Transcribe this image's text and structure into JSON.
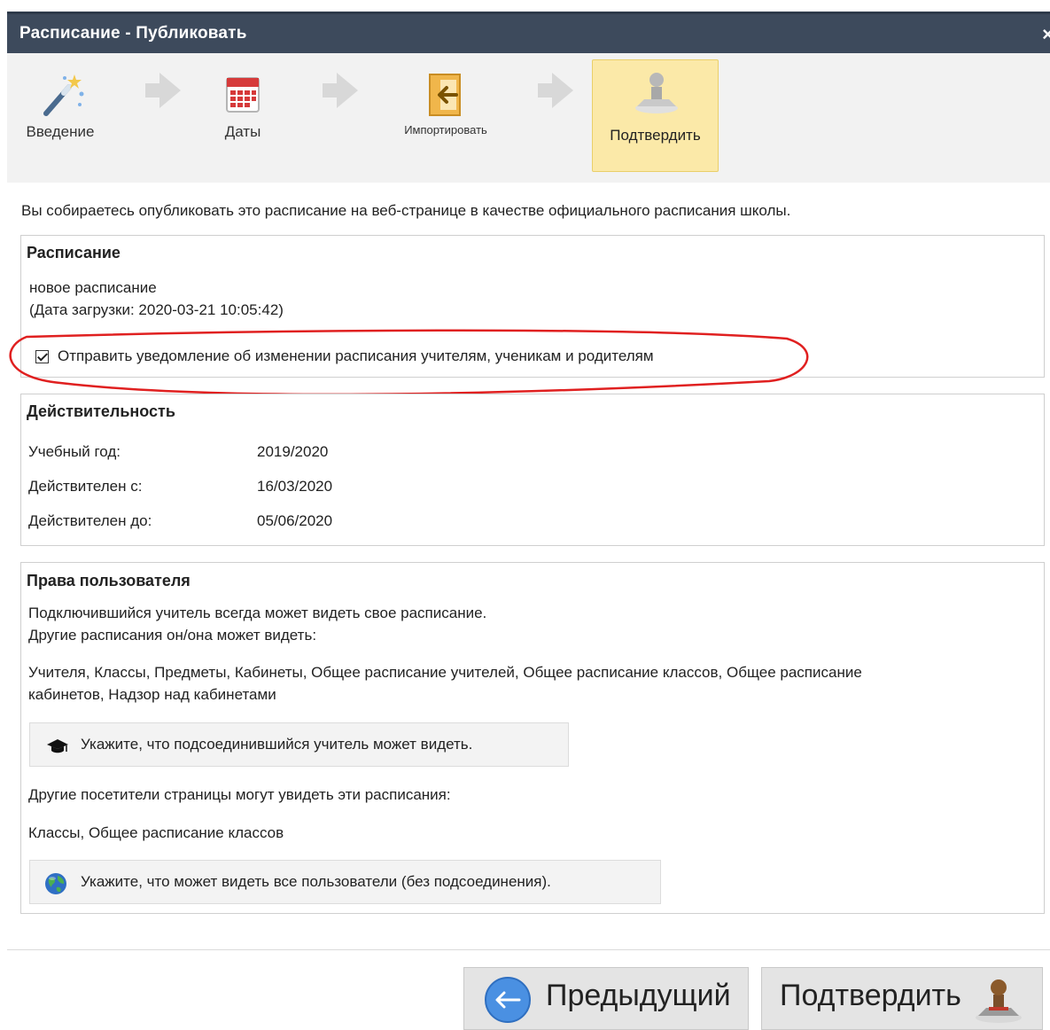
{
  "window": {
    "title": "Расписание - Публиковать",
    "close_label": "×"
  },
  "wizard": {
    "steps": [
      {
        "label": "Введение",
        "icon": "magic-wand-icon"
      },
      {
        "label": "Даты",
        "icon": "calendar-icon"
      },
      {
        "label": "Импортировать",
        "icon": "import-icon"
      },
      {
        "label": "Подтвердить",
        "icon": "stamp-icon",
        "active": true
      }
    ]
  },
  "intro": "Вы собираетесь опубликовать это расписание на веб-странице в качестве официального расписания школы.",
  "schedule_panel": {
    "heading": "Расписание",
    "name": "новое расписание",
    "upload_date": "(Дата загрузки: 2020-03-21 10:05:42)",
    "notify_checkbox": {
      "label": "Отправить уведомление об изменении расписания учителям, ученикам и родителям",
      "checked": true
    }
  },
  "validity_panel": {
    "heading": "Действительность",
    "rows": [
      {
        "label": "Учебный год:",
        "value": "2019/2020"
      },
      {
        "label": "Действителен с:",
        "value": "16/03/2020"
      },
      {
        "label": "Действителен до:",
        "value": "05/06/2020"
      }
    ]
  },
  "rights_panel": {
    "heading": "Права пользователя",
    "teacher_line1": "Подключившийся учитель всегда может видеть свое расписание.",
    "teacher_line2": "Другие расписания он/она может видеть:",
    "teacher_list_line1": "Учителя, Классы, Предметы, Кабинеты, Общее расписание учителей, Общее расписание классов, Общее расписание",
    "teacher_list_line2": "кабинетов, Надзор над кабинетами",
    "teacher_button": {
      "label": "Укажите, что подсоединившийся учитель может видеть.",
      "icon": "graduation-cap-icon"
    },
    "visitors_line": "Другие посетители страницы могут увидеть эти расписания:",
    "visitors_list": "Классы, Общее расписание классов",
    "visitors_button": {
      "label": "Укажите, что может видеть все пользователи (без подсоединения).",
      "icon": "globe-icon"
    }
  },
  "footer": {
    "prev_button": {
      "label": "Предыдущий",
      "icon": "arrow-left-circle-icon"
    },
    "confirm_button": {
      "label": "Подтвердить",
      "icon": "stamp-icon"
    }
  },
  "colors": {
    "titlebar": "#3d4a5c",
    "active_step": "#fbe9a8",
    "annotation": "#e02020"
  }
}
